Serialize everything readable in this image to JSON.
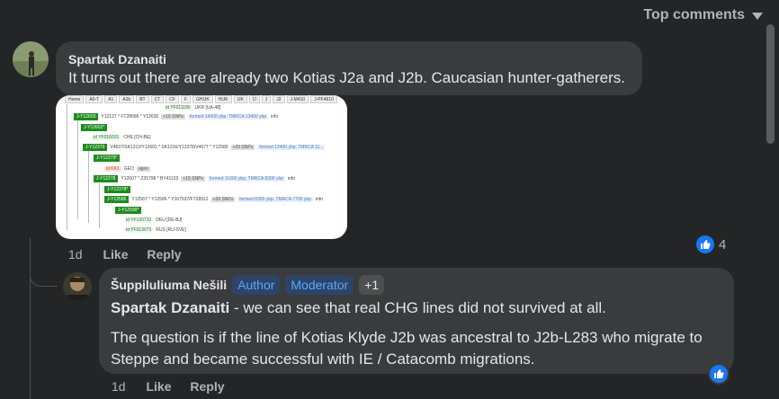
{
  "sort": {
    "label": "Top comments"
  },
  "comment1": {
    "author": "Spartak Dzanaiti",
    "text": "It turns out there are already two Kotias J2a and J2b. Caucasian hunter-gatherers.",
    "time": "1d",
    "like_label": "Like",
    "reply_label": "Reply",
    "reaction_count": "4",
    "attachment": {
      "tabs": [
        "Home",
        "A0-T",
        "A1",
        "A1b",
        "BT",
        "CT",
        "CF",
        "F",
        "GHIJK",
        "HIJK",
        "IJK",
        "IJ",
        "J",
        "J2",
        "J-M410",
        "J-PF4610"
      ],
      "rows": [
        {
          "label": "id YF011180",
          "extra": "UKR [UA-48]"
        },
        {
          "label": "J-Y12603",
          "extra": "Y12127 * FT28686 * Y12630",
          "snps": "+16 SNPs",
          "formed": "formed 14900 ybp, TMRCA 13400 ybp",
          "info": "info"
        },
        {
          "label": "J-Y12602*",
          "extra": ""
        },
        {
          "label": "id YF016031",
          "extra": "CHE [CH-BE]"
        },
        {
          "label": "J-Y12379",
          "extra": "V4637/SK1312/Y12601 * SK1316/Y12378/V4677 * Y12580",
          "snps": "+29 SNPs",
          "formed": "formed 13400 ybp, TMRCA 11..."
        },
        {
          "label": "J-Y12379*",
          "extra": ""
        },
        {
          "label": "id KK1",
          "extra": "GEO",
          "ages": "ages"
        },
        {
          "label": "J-Y12378",
          "extra": "Y12607 * Z35798 * BY41103",
          "snps": "+15 SNPs",
          "formed": "formed 11000 ybp, TMRCA 8300 ybp",
          "info": "info"
        },
        {
          "label": "J-Y12378*",
          "extra": ""
        },
        {
          "label": "J-Y12586",
          "extra": "Y12567 * Y12586 * Y167537/FT28912",
          "snps": "+29 SNPs",
          "formed": "formed 8300 ybp, TMRCA 7700 ybp",
          "info": "info"
        },
        {
          "label": "J-Y12599*",
          "extra": ""
        },
        {
          "label": "id YF120732",
          "extra": "DEU [DE-BJ]"
        },
        {
          "label": "id YF013073",
          "extra": "RUS [RU-SVE]"
        }
      ]
    }
  },
  "reply1": {
    "author": "Šuppiluliuma Nešili",
    "badges": [
      "Author",
      "Moderator"
    ],
    "extra_badge": "+1",
    "mention": "Spartak Dzanaiti",
    "text1": " - we can see that real CHG lines did not survived at all.",
    "text2": "The question is if the line of Kotias Klyde J2b was ancestral to J2b-L283 who migrate to Steppe and became successful with IE / Catacomb migrations.",
    "time": "1d",
    "like_label": "Like",
    "reply_label": "Reply"
  },
  "icons": {
    "like": "thumbs-up-icon",
    "sort": "chevron-down-icon"
  },
  "colors": {
    "background": "#242526",
    "bubble": "#3a3b3c",
    "accent": "#1877f2",
    "badge_text": "#5aa7ff"
  }
}
